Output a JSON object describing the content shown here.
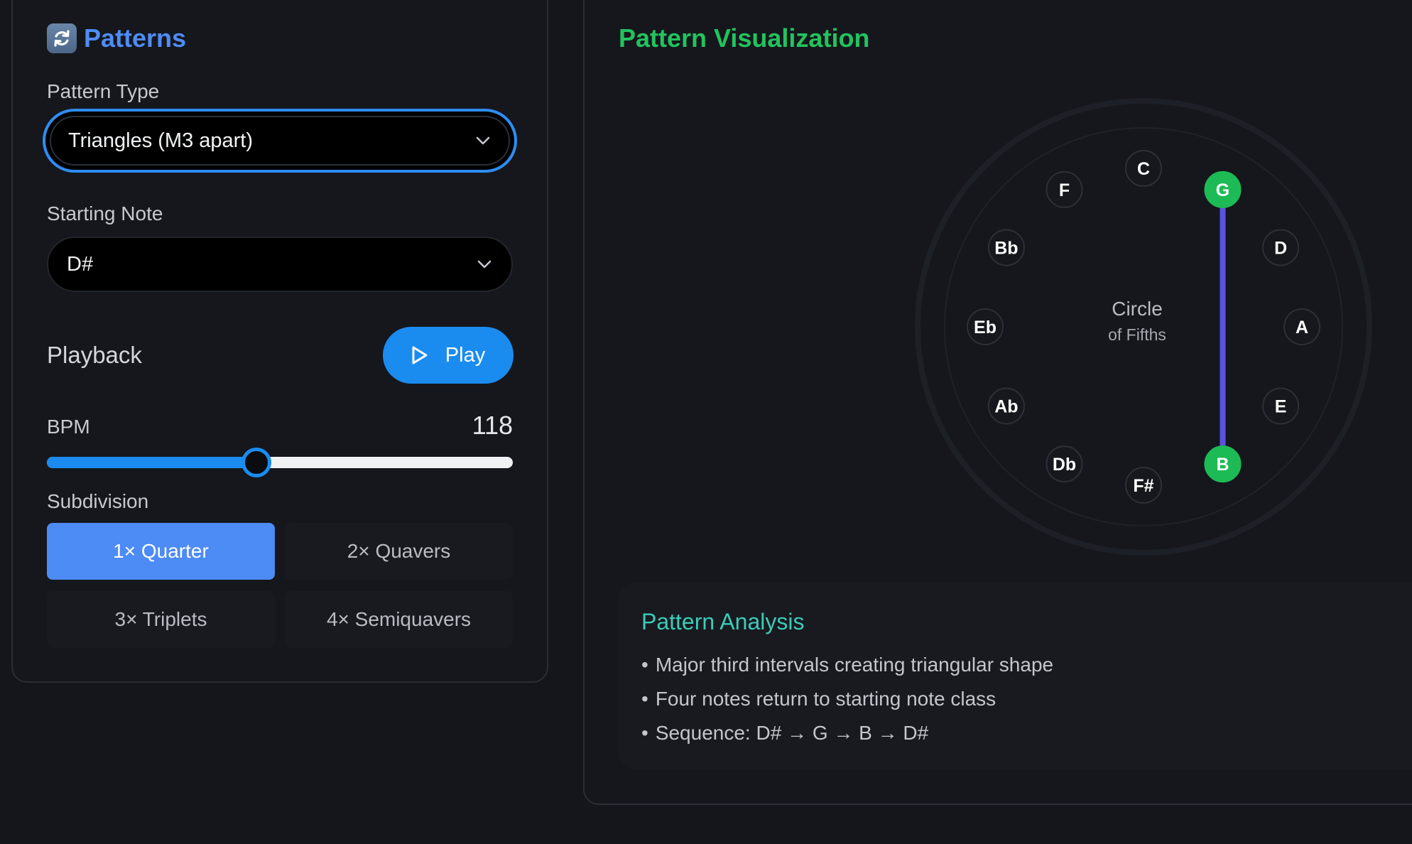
{
  "patterns_panel": {
    "title": "Patterns",
    "pattern_type": {
      "label": "Pattern Type",
      "value": "Triangles (M3 apart)"
    },
    "starting_note": {
      "label": "Starting Note",
      "value": "D#"
    },
    "playback": {
      "label": "Playback",
      "play_label": "Play"
    },
    "bpm": {
      "label": "BPM",
      "value": "118",
      "slider_fraction": 0.45
    },
    "subdivision": {
      "label": "Subdivision",
      "options": [
        "1× Quarter",
        "2× Quavers",
        "3× Triplets",
        "4× Semiquavers"
      ],
      "selected": "1× Quarter"
    }
  },
  "visualization": {
    "title": "Pattern Visualization",
    "circle": {
      "center_title": "Circle",
      "center_subtitle": "of Fifths",
      "notes": [
        "C",
        "G",
        "D",
        "A",
        "E",
        "B",
        "F#",
        "Db",
        "Ab",
        "Eb",
        "Bb",
        "F"
      ],
      "highlighted": [
        "G",
        "B"
      ],
      "connections": [
        [
          "G",
          "B"
        ]
      ]
    },
    "analysis": {
      "title": "Pattern Analysis",
      "points": [
        "Major third intervals creating triangular shape",
        "Four notes return to starting note class",
        "Sequence: D# → G → B → D#"
      ]
    }
  },
  "colors": {
    "accent_blue": "#1a8cf0",
    "title_blue": "#4f8cf5",
    "viz_green": "#22c35e",
    "highlight_note": "#1dbb55",
    "connection_line": "#5a52e0",
    "analysis_teal": "#3ccbb8"
  }
}
